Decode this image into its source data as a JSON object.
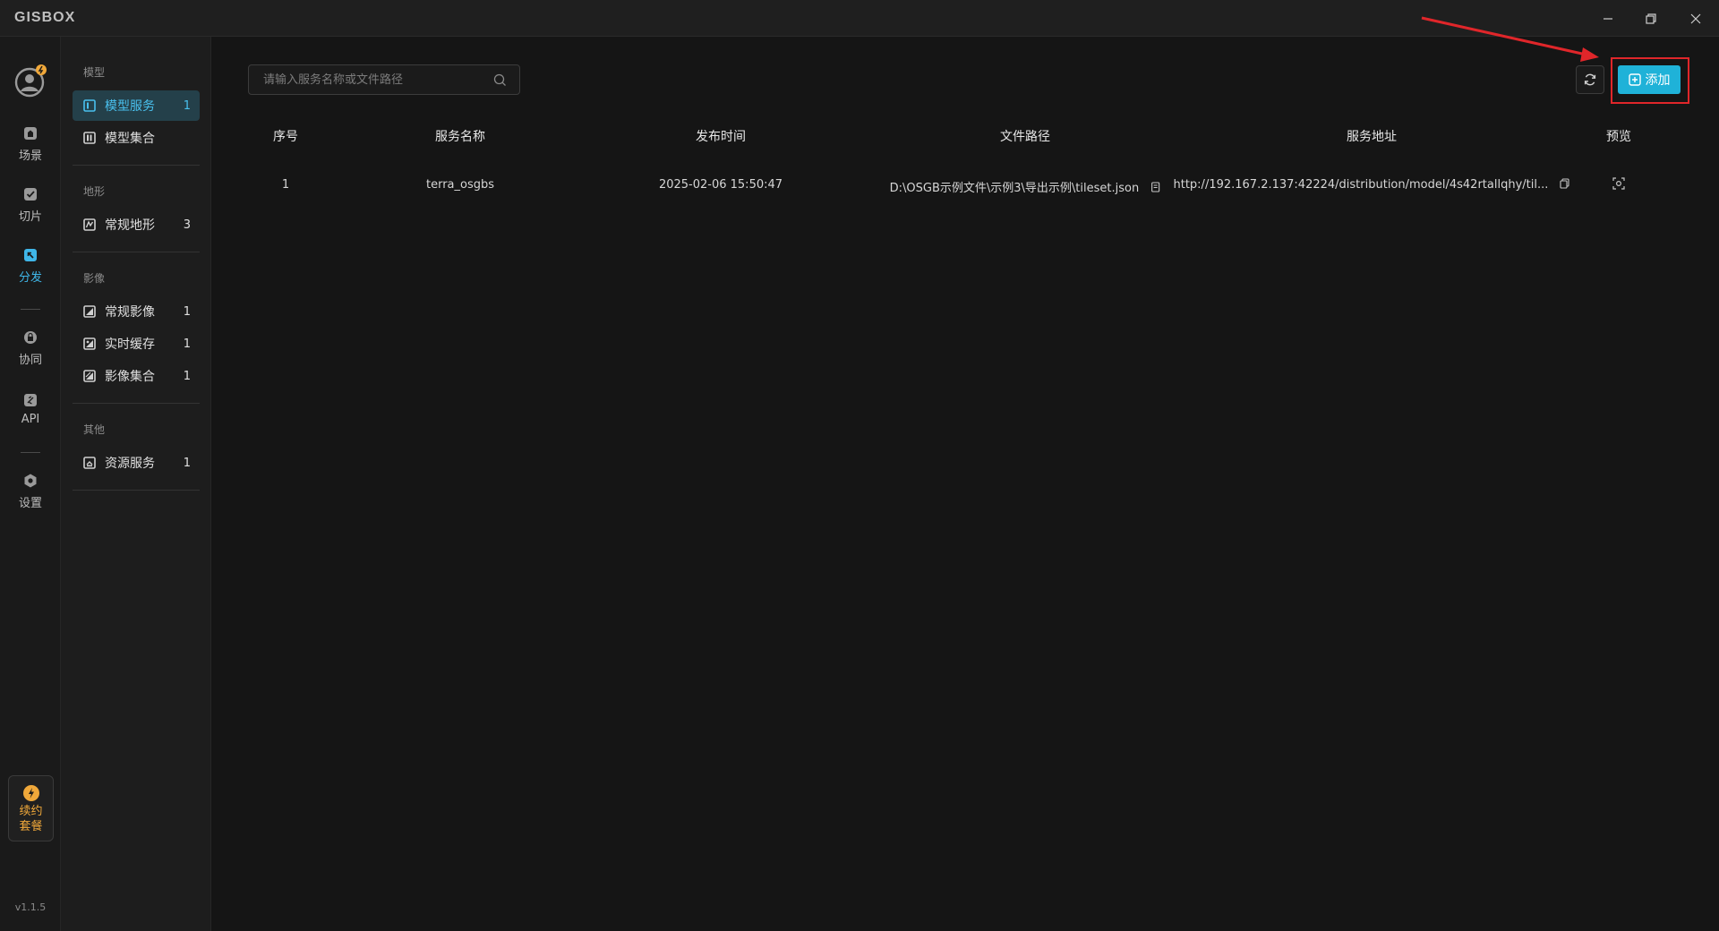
{
  "app": {
    "logo": "GISBOX",
    "version": "v1.1.5"
  },
  "rail": {
    "items": [
      {
        "label": "场景",
        "icon": "scene-icon"
      },
      {
        "label": "切片",
        "icon": "tile-icon"
      },
      {
        "label": "分发",
        "icon": "distribute-icon",
        "active": true
      },
      {
        "label": "协同",
        "icon": "collab-icon"
      },
      {
        "label": "API",
        "icon": "api-icon"
      },
      {
        "label": "设置",
        "icon": "settings-icon"
      }
    ],
    "renew_line1": "续约",
    "renew_line2": "套餐"
  },
  "sidebar": {
    "groups": [
      {
        "title": "模型",
        "items": [
          {
            "label": "模型服务",
            "count": "1",
            "active": true
          },
          {
            "label": "模型集合",
            "count": ""
          }
        ]
      },
      {
        "title": "地形",
        "items": [
          {
            "label": "常规地形",
            "count": "3"
          }
        ]
      },
      {
        "title": "影像",
        "items": [
          {
            "label": "常规影像",
            "count": "1"
          },
          {
            "label": "实时缓存",
            "count": "1"
          },
          {
            "label": "影像集合",
            "count": "1"
          }
        ]
      },
      {
        "title": "其他",
        "items": [
          {
            "label": "资源服务",
            "count": "1"
          }
        ]
      }
    ]
  },
  "toolbar": {
    "search_placeholder": "请输入服务名称或文件路径",
    "add_label": "添加"
  },
  "table": {
    "columns": [
      "序号",
      "服务名称",
      "发布时间",
      "文件路径",
      "服务地址",
      "预览"
    ],
    "rows": [
      {
        "index": "1",
        "name": "terra_osgbs",
        "time": "2025-02-06 15:50:47",
        "path": "D:\\OSGB示例文件\\示例3\\导出示例\\tileset.json",
        "url": "http://192.167.2.137:42224/distribution/model/4s42rtallqhy/til..."
      }
    ]
  },
  "colors": {
    "accent": "#1fb2d8",
    "highlight": "#e0262a",
    "renew": "#f0a83a"
  }
}
